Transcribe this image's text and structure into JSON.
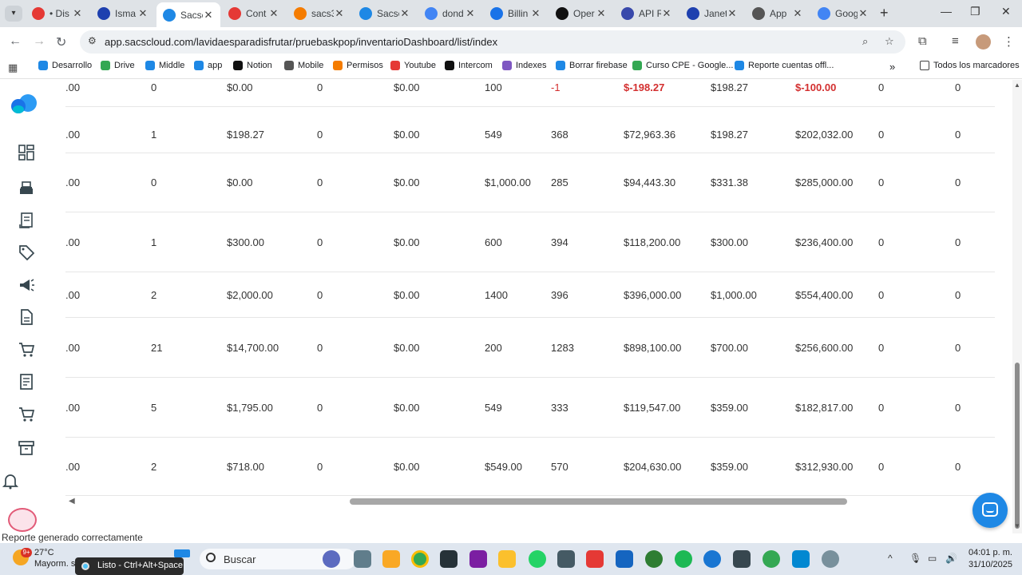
{
  "browser": {
    "tabs": [
      {
        "title": "• Dis",
        "color": "#e53935",
        "icon": "chrome-icon",
        "active": false
      },
      {
        "title": "Isma",
        "color": "#1e40af",
        "icon": "jira-icon",
        "active": false
      },
      {
        "title": "Sacsc",
        "color": "#1e88e5",
        "icon": "sacs-icon",
        "active": true
      },
      {
        "title": "Cont",
        "color": "#e53935",
        "icon": "youtube-icon",
        "active": false
      },
      {
        "title": "sacs3",
        "color": "#f57c00",
        "icon": "firebase-icon",
        "active": false
      },
      {
        "title": "Sacsc",
        "color": "#1e88e5",
        "icon": "sacs-icon",
        "active": false
      },
      {
        "title": "dond",
        "color": "#4285f4",
        "icon": "google-icon",
        "active": false
      },
      {
        "title": "Billin",
        "color": "#1a73e8",
        "icon": "billing-icon",
        "active": false
      },
      {
        "title": "Oper",
        "color": "#111111",
        "icon": "openai-icon",
        "active": false
      },
      {
        "title": "API R",
        "color": "#3949ab",
        "icon": "api-icon",
        "active": false
      },
      {
        "title": "Janet",
        "color": "#1e40af",
        "icon": "jira-icon",
        "active": false
      },
      {
        "title": "App",
        "color": "#555555",
        "icon": "globe-icon",
        "active": false
      },
      {
        "title": "Goog",
        "color": "#4285f4",
        "icon": "gemini-icon",
        "active": false
      }
    ],
    "url": "app.sacscloud.com/lavidaesparadisfrutar/pruebaskpop/inventarioDashboard/list/index",
    "bookmarks": [
      {
        "label": "Desarrollo",
        "color": "#1e88e5"
      },
      {
        "label": "Drive",
        "color": "#34a853"
      },
      {
        "label": "Middle",
        "color": "#1e88e5"
      },
      {
        "label": "app",
        "color": "#1e88e5"
      },
      {
        "label": "Notion",
        "color": "#111111"
      },
      {
        "label": "Mobile",
        "color": "#555555"
      },
      {
        "label": "Permisos",
        "color": "#f57c00"
      },
      {
        "label": "Youtube",
        "color": "#e53935"
      },
      {
        "label": "Intercom",
        "color": "#111111"
      },
      {
        "label": "Indexes",
        "color": "#7e57c2"
      },
      {
        "label": "Borrar firebase",
        "color": "#1e88e5"
      },
      {
        "label": "Curso CPE - Google...",
        "color": "#34a853"
      },
      {
        "label": "Reporte cuentas offl...",
        "color": "#1e88e5"
      }
    ],
    "bookmarks_overflow": "»",
    "all_bookmarks": "Todos los marcadores"
  },
  "sidebar": {
    "items": [
      {
        "name": "dashboard-icon"
      },
      {
        "name": "cash-register-icon"
      },
      {
        "name": "receipt-icon"
      },
      {
        "name": "tag-icon"
      },
      {
        "name": "megaphone-icon"
      },
      {
        "name": "document-icon"
      },
      {
        "name": "cart-icon"
      },
      {
        "name": "invoice-icon"
      },
      {
        "name": "cart-alt-icon"
      },
      {
        "name": "archive-icon"
      },
      {
        "name": "bell-icon"
      }
    ]
  },
  "table": {
    "rows": [
      {
        "c": [
          ".00",
          "0",
          "$0.00",
          "0",
          "$0.00",
          "100",
          "-1",
          "$-198.27",
          "$198.27",
          "$-100.00",
          "0",
          "0"
        ],
        "neg": [
          6,
          7,
          9
        ]
      },
      {
        "c": [
          ".00",
          "1",
          "$198.27",
          "0",
          "$0.00",
          "549",
          "368",
          "$72,963.36",
          "$198.27",
          "$202,032.00",
          "0",
          "0"
        ],
        "neg": []
      },
      {
        "c": [
          ".00",
          "0",
          "$0.00",
          "0",
          "$0.00",
          "$1,000.00",
          "285",
          "$94,443.30",
          "$331.38",
          "$285,000.00",
          "0",
          "0"
        ],
        "neg": []
      },
      {
        "c": [
          ".00",
          "1",
          "$300.00",
          "0",
          "$0.00",
          "600",
          "394",
          "$118,200.00",
          "$300.00",
          "$236,400.00",
          "0",
          "0"
        ],
        "neg": []
      },
      {
        "c": [
          ".00",
          "2",
          "$2,000.00",
          "0",
          "$0.00",
          "1400",
          "396",
          "$396,000.00",
          "$1,000.00",
          "$554,400.00",
          "0",
          "0"
        ],
        "neg": []
      },
      {
        "c": [
          ".00",
          "21",
          "$14,700.00",
          "0",
          "$0.00",
          "200",
          "1283",
          "$898,100.00",
          "$700.00",
          "$256,600.00",
          "0",
          "0"
        ],
        "neg": []
      },
      {
        "c": [
          ".00",
          "5",
          "$1,795.00",
          "0",
          "$0.00",
          "549",
          "333",
          "$119,547.00",
          "$359.00",
          "$182,817.00",
          "0",
          "0"
        ],
        "neg": []
      },
      {
        "c": [
          ".00",
          "2",
          "$718.00",
          "0",
          "$0.00",
          "$549.00",
          "570",
          "$204,630.00",
          "$359.00",
          "$312,930.00",
          "0",
          "0"
        ],
        "neg": []
      }
    ]
  },
  "status_message": "Reporte generado correctamente",
  "taskbar": {
    "weather_temp": "27°C",
    "weather_desc": "Mayorm. so",
    "weather_badge": "9+",
    "tooltip": "Listo - Ctrl+Alt+Space",
    "search": "Buscar",
    "time": "04:01 p. m.",
    "date": "31/10/2025"
  }
}
